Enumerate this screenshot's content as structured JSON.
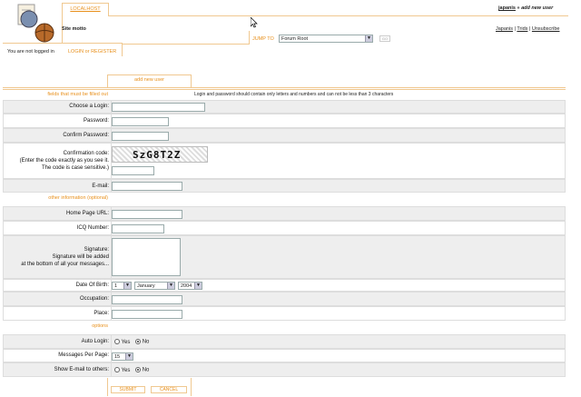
{
  "header": {
    "tab_host": "LOCALHOST",
    "site_motto": "Site motto",
    "nav_links": [
      "Japanis",
      "Trids",
      "Unsubscribe"
    ],
    "nav_separator": "|",
    "signup_user": "japanis",
    "signup_sep": "»",
    "signup_page": "add new user",
    "jump_label": "JUMP TO",
    "jump_select": "Forum Root",
    "jump_go": "GO",
    "login_status": "You are not logged in",
    "login_link": "LOGIN",
    "or_text": "or",
    "register_link": "REGISTER",
    "page_tab": "add new user"
  },
  "form": {
    "required_title": "fields that must be filled out",
    "note": "Login and password should contain only letters and numbers and can not be less than 3 characters",
    "login_label": "Choose a Login:",
    "password_label": "Password:",
    "confirm_password_label": "Confirm Password:",
    "confirmation_label_1": "Confirmation code:",
    "confirmation_label_2": "(Enter the code exactly as you see it.",
    "confirmation_label_3": "The code is case sensitive.)",
    "captcha": "SzG8T2Z",
    "email_label": "E-mail:",
    "optional_title": "other information (optional)",
    "homepage_label": "Home Page URL:",
    "icq_label": "ICQ Number:",
    "signature_label_1": "Signature:",
    "signature_label_2": "Signature will be added",
    "signature_label_3": "at the bottom of all your messages...",
    "dob_label": "Date Of Birth:",
    "dob_day": "1",
    "dob_month": "January",
    "dob_year": "2004",
    "occupation_label": "Occupation:",
    "place_label": "Place:",
    "options_title": "options",
    "autologin_label": "Auto Login:",
    "yes": "Yes",
    "no": "No",
    "mpp_label": "Messages Per Page:",
    "mpp_value": "15",
    "showemail_label": "Show E-mail to others:",
    "submit": "SUBMIT",
    "cancel": "CANCEL"
  },
  "colors": {
    "accent": "#e8901c",
    "border": "#f0c890",
    "row_grey": "#eeeeee"
  }
}
